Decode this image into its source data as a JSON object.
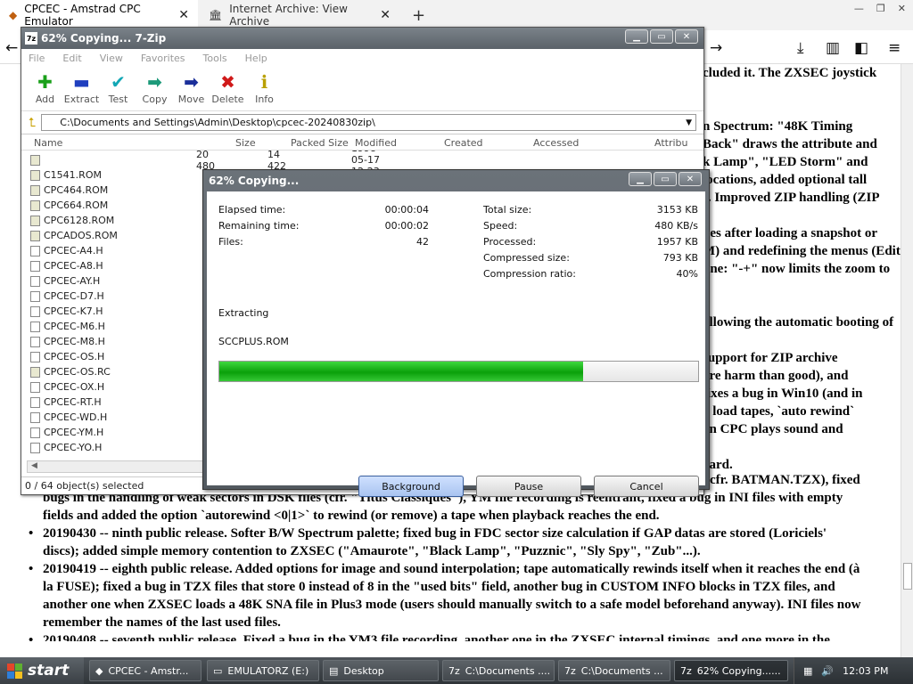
{
  "browser": {
    "tabs": [
      {
        "title": "CPCEC - Amstrad CPC Emulator"
      },
      {
        "title": "Internet Archive: View Archive"
      }
    ],
    "new_tab": "+",
    "close_glyph": "✕"
  },
  "page": {
    "right_lines": [
      "cluded it. The ZXSEC joystick",
      "",
      "",
      "n Spectrum: \"48K Timing",
      "Back\" draws the attribute and",
      "k Lamp\", \"LED Storm\" and",
      "locations, added optional tall",
      "s. Improved ZIP handling (ZIP",
      "",
      "pes after loading a snapshot or",
      "M) and redefining the menus (Edit",
      "line: \"-+\" now limits the zoom to",
      "",
      "",
      "allowing the automatic booting of",
      "",
      "support for ZIP archive",
      "ore harm than good), and",
      "fixes a bug in Win10 (and in",
      "o load tapes, `auto rewind`",
      "on CPC plays sound and",
      "",
      "oard."
    ],
    "partial_right": "cfr. BATMAN.TZX), fixed",
    "full_lines": [
      {
        "bullet": false,
        "text": "bugs in the handling of weak sectors in DSK files (cfr. \"Titus Classiques\"), YM file recording is reentrant, fixed a bug in INI files with empty"
      },
      {
        "bullet": false,
        "text": "fields and added the option `autorewind <0|1>` to rewind (or remove) a tape when playback reaches the end."
      },
      {
        "bullet": true,
        "text": "20190430 -- ninth public release. Softer B/W Spectrum palette; fixed bug in FDC sector size calculation if GAP datas are stored (Loriciels'"
      },
      {
        "bullet": false,
        "text": "discs); added simple memory contention to ZXSEC (\"Amaurote\", \"Black Lamp\", \"Puzznic\", \"Sly Spy\", \"Zub\"...)."
      },
      {
        "bullet": true,
        "text": "20190419 -- eighth public release. Added options for image and sound interpolation; tape automatically rewinds itself when it reaches the end (à"
      },
      {
        "bullet": false,
        "text": "la FUSE); fixed a bug in TZX files that store 0 instead of 8 in the \"used bits\" field, another bug in CUSTOM INFO blocks in TZX files, and"
      },
      {
        "bullet": false,
        "text": "another one when ZXSEC loads a 48K SNA file in Plus3 mode (users should manually switch to a safe model beforehand anyway). INI files now"
      },
      {
        "bullet": false,
        "text": "remember the names of the last used files."
      },
      {
        "bullet": true,
        "text": "20190408 -- seventh public release. Fixed a bug in the YM3 file recording, another one in the ZXSEC internal timings, and one more in the"
      }
    ]
  },
  "sevenzip": {
    "title": "62% Copying... 7-Zip",
    "logo": "7z",
    "menu": [
      "File",
      "Edit",
      "View",
      "Favorites",
      "Tools",
      "Help"
    ],
    "toolbar": [
      {
        "label": "Add",
        "icon": "plus-icon",
        "glyph": "✚",
        "color": "#1aa01a"
      },
      {
        "label": "Extract",
        "icon": "minus-icon",
        "glyph": "▬",
        "color": "#1f3fbf"
      },
      {
        "label": "Test",
        "icon": "checkmark-icon",
        "glyph": "✔",
        "color": "#12a7b5"
      },
      {
        "label": "Copy",
        "icon": "copy-arrow-icon",
        "glyph": "➡",
        "color": "#1d9a7a"
      },
      {
        "label": "Move",
        "icon": "move-arrow-icon",
        "glyph": "➡",
        "color": "#1b2f9a"
      },
      {
        "label": "Delete",
        "icon": "delete-x-icon",
        "glyph": "✖",
        "color": "#d01a1a"
      },
      {
        "label": "Info",
        "icon": "info-icon",
        "glyph": "ℹ",
        "color": "#b9a000"
      }
    ],
    "path": "C:\\Documents and Settings\\Admin\\Desktop\\cpcec-20240830zip\\",
    "columns": [
      "Name",
      "Size",
      "Packed Size",
      "Modified",
      "Created",
      "Accessed",
      "Attribu"
    ],
    "first_row": {
      "size": "20 480",
      "packed": "14 422",
      "modified": "1998-05-17 12:23"
    },
    "files": [
      "C1541.ROM",
      "CPC464.ROM",
      "CPC664.ROM",
      "CPC6128.ROM",
      "CPCADOS.ROM",
      "CPCEC-A4.H",
      "CPCEC-A8.H",
      "CPCEC-AY.H",
      "CPCEC-D7.H",
      "CPCEC-K7.H",
      "CPCEC-M6.H",
      "CPCEC-M8.H",
      "CPCEC-OS.H",
      "CPCEC-OS.RC",
      "CPCEC-OX.H",
      "CPCEC-RT.H",
      "CPCEC-WD.H",
      "CPCEC-YM.H",
      "CPCEC-YO.H"
    ],
    "status": "0 / 64 object(s) selected"
  },
  "dialog": {
    "title": "62% Copying...",
    "left": [
      {
        "label": "Elapsed time:",
        "value": "00:00:04"
      },
      {
        "label": "Remaining time:",
        "value": "00:00:02"
      },
      {
        "label": "Files:",
        "value": "42"
      }
    ],
    "right": [
      {
        "label": "Total size:",
        "value": "3153 KB"
      },
      {
        "label": "Speed:",
        "value": "480 KB/s"
      },
      {
        "label": "Processed:",
        "value": "1957 KB"
      },
      {
        "label": "Compressed size:",
        "value": "793 KB"
      },
      {
        "label": "Compression ratio:",
        "value": "40%"
      }
    ],
    "operation": "Extracting",
    "current_file": "SCCPLUS.ROM",
    "progress": 0.76,
    "buttons": {
      "background": "Background",
      "pause": "Pause",
      "cancel": "Cancel"
    }
  },
  "taskbar": {
    "start": "start",
    "items": [
      {
        "label": "CPCEC - Amstr...",
        "icon": "browser-icon",
        "active": false
      },
      {
        "label": "EMULATORZ (E:)",
        "icon": "drive-icon",
        "active": false
      },
      {
        "label": "Desktop",
        "icon": "folder-icon",
        "active": false
      },
      {
        "label": "C:\\Documents ....",
        "icon": "7zip-icon",
        "active": false
      },
      {
        "label": "C:\\Documents ...",
        "icon": "7zip-icon",
        "active": false
      },
      {
        "label": "62% Copying......",
        "icon": "7zip-icon",
        "active": true
      }
    ],
    "clock": "12:03 PM"
  },
  "colors": {
    "progress_fill": "#19b719",
    "title_bar": "#5f666d",
    "taskbar": "#3a3f44"
  }
}
